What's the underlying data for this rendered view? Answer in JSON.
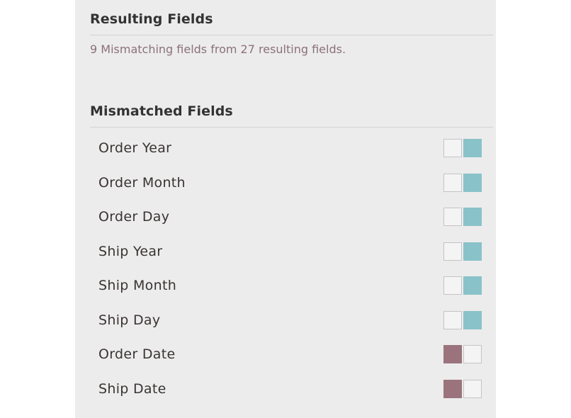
{
  "resulting": {
    "title": "Resulting Fields",
    "summary": "9 Mismatching fields from 27 resulting fields."
  },
  "mismatched": {
    "title": "Mismatched Fields",
    "colors": {
      "left_source": "#9b737c",
      "right_source": "#8ac2c9",
      "empty": "#f4f4f4"
    },
    "fields": [
      {
        "label": "Order Year",
        "left": false,
        "right": true
      },
      {
        "label": "Order Month",
        "left": false,
        "right": true
      },
      {
        "label": "Order Day",
        "left": false,
        "right": true
      },
      {
        "label": "Ship Year",
        "left": false,
        "right": true
      },
      {
        "label": "Ship Month",
        "left": false,
        "right": true
      },
      {
        "label": "Ship Day",
        "left": false,
        "right": true
      },
      {
        "label": "Order Date",
        "left": true,
        "right": false
      },
      {
        "label": "Ship Date",
        "left": true,
        "right": false
      }
    ]
  }
}
